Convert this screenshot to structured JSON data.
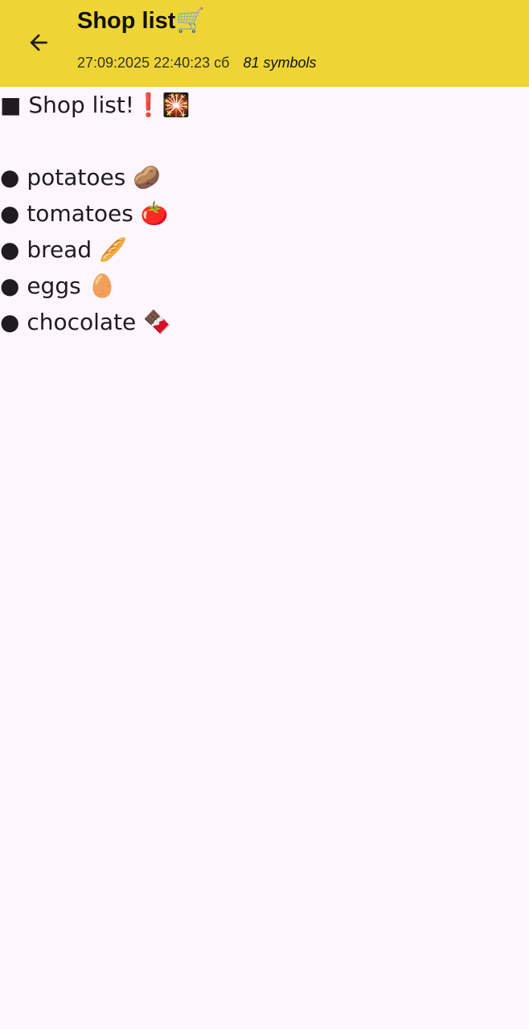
{
  "header": {
    "title": "Shop list🛒",
    "date": "27:09:2025 22:40:23 сб",
    "symbols": "81 symbols",
    "back_icon": "arrow-left-icon",
    "background_color": "#EED535"
  },
  "note": {
    "lines": [
      "■ Shop list!❗🎇",
      "",
      "● potatoes 🥔",
      "● tomatoes 🍅",
      "● bread 🥖",
      "● eggs 🥚",
      "● chocolate 🍫"
    ]
  }
}
